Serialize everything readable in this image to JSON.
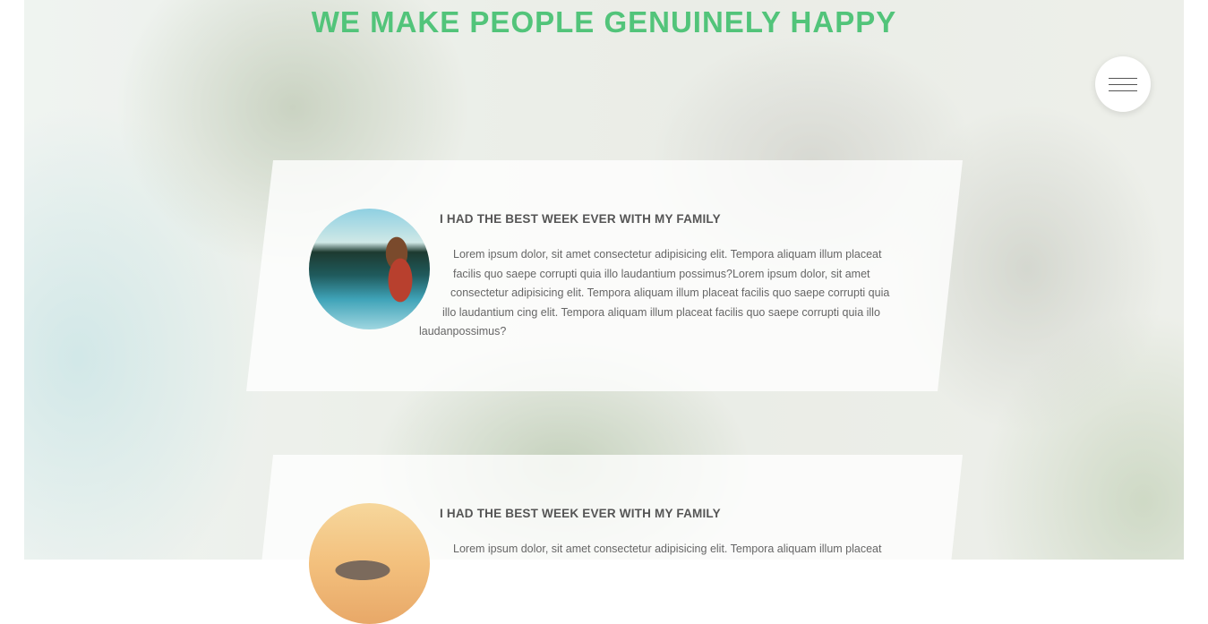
{
  "hero": {
    "title": "WE MAKE PEOPLE GENUINELY HAPPY"
  },
  "menu": {
    "icon": "hamburger-menu-icon"
  },
  "testimonials": [
    {
      "heading": "I HAD THE BEST WEEK EVER WITH MY FAMILY",
      "lines": [
        "Lorem ipsum dolor, sit amet consectetur adipisicing elit. Tempora aliquam illum placeat",
        "facilis quo saepe corrupti quia illo laudantium possimus?Lorem ipsum dolor, sit amet",
        "consectetur adipisicing elit. Tempora aliquam illum placeat facilis quo saepe corrupti quia",
        "illo laudantium cing elit. Tempora aliquam illum placeat facilis quo saepe corrupti quia illo",
        "laudanpossimus?"
      ]
    },
    {
      "heading": "I HAD THE BEST WEEK EVER WITH MY FAMILY",
      "lines": [
        "Lorem ipsum dolor, sit amet consectetur adipisicing elit. Tempora aliquam illum placeat"
      ]
    }
  ]
}
